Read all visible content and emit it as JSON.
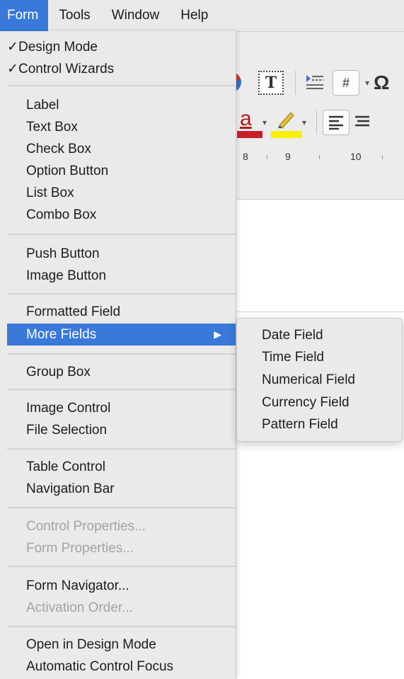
{
  "menubar": {
    "items": [
      "Form",
      "Tools",
      "Window",
      "Help"
    ],
    "active": "Form"
  },
  "form_menu": {
    "check_mark": "✓",
    "design_mode": "Design Mode",
    "control_wizards": "Control Wizards",
    "label": "Label",
    "text_box": "Text Box",
    "check_box": "Check Box",
    "option_button": "Option Button",
    "list_box": "List Box",
    "combo_box": "Combo Box",
    "push_button": "Push Button",
    "image_button": "Image Button",
    "formatted_field": "Formatted Field",
    "more_fields": "More Fields",
    "group_box": "Group Box",
    "image_control": "Image Control",
    "file_selection": "File Selection",
    "table_control": "Table Control",
    "navigation_bar": "Navigation Bar",
    "control_properties": "Control Properties...",
    "form_properties": "Form Properties...",
    "form_navigator": "Form Navigator...",
    "activation_order": "Activation Order...",
    "open_in_design_mode": "Open in Design Mode",
    "automatic_control_focus": "Automatic Control Focus",
    "submenu_arrow": "▶"
  },
  "more_fields_submenu": {
    "date_field": "Date Field",
    "time_field": "Time Field",
    "numerical_field": "Numerical Field",
    "currency_field": "Currency Field",
    "pattern_field": "Pattern Field"
  },
  "toolbar": {
    "text_tool_glyph": "T",
    "field_glyph": "#",
    "special_char_glyph": "Ω",
    "font_color_glyph": "a",
    "dropdown_glyph": "▾",
    "font_color": "#c81e2a",
    "highlight_color": "#f6f100"
  },
  "ruler": {
    "marks": [
      "8",
      "9",
      "10"
    ]
  },
  "colors": {
    "accent": "#3879d9",
    "menu_bg": "#eaeaea",
    "disabled_text": "#a3a3a3"
  }
}
